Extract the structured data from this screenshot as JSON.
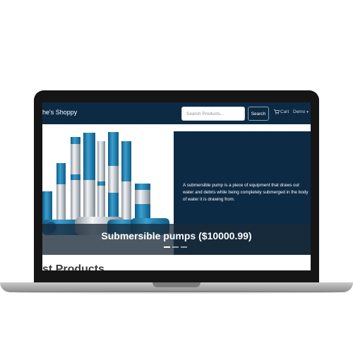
{
  "navbar": {
    "brand": "he's Shoppy",
    "search_placeholder": "Search Products...",
    "search_button": "Search",
    "cart_label": "Cart",
    "user_label": "Demo",
    "background": "#0d2a44"
  },
  "carousel": {
    "description": "A submersible pump is a piece of equipment that draws out water and debris while being completely submerged in the body of water it is drawing from.",
    "caption": "Submersible pumps ($10000.99)",
    "indicator_count": 3,
    "active_indicator": 0
  },
  "section": {
    "heading": "st Products"
  },
  "icons": {
    "cart": "cart-icon",
    "dropdown": "caret-down-icon"
  },
  "colors": {
    "pump_blue": "#1f7fb0",
    "steel": "#c4cbd1",
    "panel": "#0d2a44"
  }
}
